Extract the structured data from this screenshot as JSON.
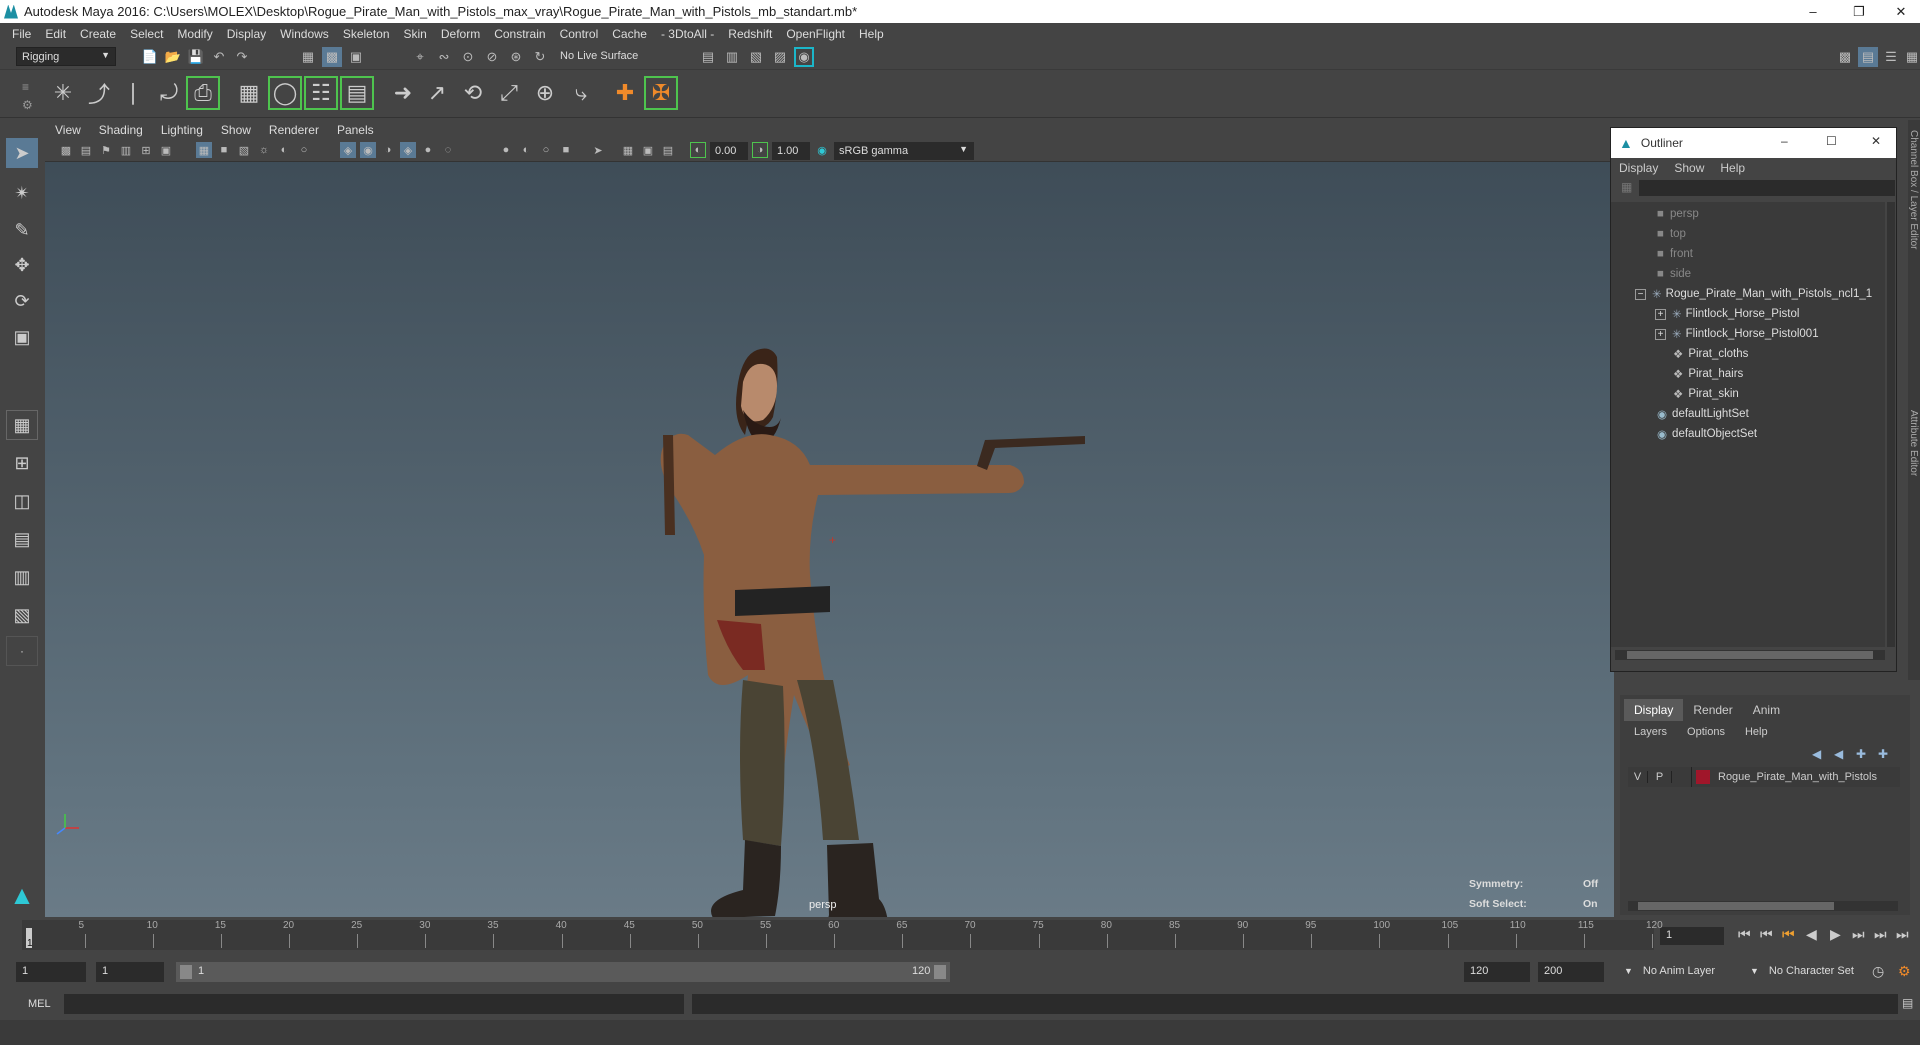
{
  "window": {
    "title": "Autodesk Maya 2016: C:\\Users\\MOLEX\\Desktop\\Rogue_Pirate_Man_with_Pistols_max_vray\\Rogue_Pirate_Man_with_Pistols_mb_standart.mb*"
  },
  "menu": [
    "File",
    "Edit",
    "Create",
    "Select",
    "Modify",
    "Display",
    "Windows",
    "Skeleton",
    "Skin",
    "Deform",
    "Constrain",
    "Control",
    "Cache",
    "- 3DtoAll -",
    "Redshift",
    "OpenFlight",
    "Help"
  ],
  "status": {
    "menuset": "Rigging",
    "live_surface": "No Live Surface"
  },
  "panel": {
    "menu": [
      "View",
      "Shading",
      "Lighting",
      "Show",
      "Renderer",
      "Panels"
    ],
    "near_value": "0.00",
    "far_value": "1.00",
    "color_space": "sRGB gamma",
    "camera_label": "persp"
  },
  "hud": {
    "symmetry_label": "Symmetry:",
    "symmetry_value": "Off",
    "soft_select_label": "Soft Select:",
    "soft_select_value": "On"
  },
  "outliner": {
    "title": "Outliner",
    "menu": [
      "Display",
      "Show",
      "Help"
    ],
    "items": [
      {
        "label": "persp",
        "dim": true
      },
      {
        "label": "top",
        "dim": true
      },
      {
        "label": "front",
        "dim": true
      },
      {
        "label": "side",
        "dim": true
      },
      {
        "label": "Rogue_Pirate_Man_with_Pistols_ncl1_1"
      },
      {
        "label": "Flintlock_Horse_Pistol"
      },
      {
        "label": "Flintlock_Horse_Pistol001"
      },
      {
        "label": "Pirat_cloths"
      },
      {
        "label": "Pirat_hairs"
      },
      {
        "label": "Pirat_skin"
      },
      {
        "label": "defaultLightSet"
      },
      {
        "label": "defaultObjectSet"
      }
    ]
  },
  "layers": {
    "tabs": [
      "Display",
      "Render",
      "Anim"
    ],
    "menu": [
      "Layers",
      "Options",
      "Help"
    ],
    "row": {
      "v": "V",
      "p": "P",
      "name": "Rogue_Pirate_Man_with_Pistols",
      "color": "#a0162a"
    }
  },
  "side_tabs": [
    "Channel Box / Layer Editor",
    "Attribute Editor"
  ],
  "timeline": {
    "ticks": [
      "5",
      "10",
      "15",
      "20",
      "25",
      "30",
      "35",
      "40",
      "45",
      "50",
      "55",
      "60",
      "65",
      "70",
      "75",
      "80",
      "85",
      "90",
      "95",
      "100",
      "105",
      "110",
      "115",
      "120"
    ],
    "current_frame": "1",
    "current_frame_field": "1"
  },
  "range": {
    "start": "1",
    "playback_start": "1",
    "slider_start": "1",
    "slider_end": "120",
    "playback_end": "120",
    "end": "200",
    "anim_layer": "No Anim Layer",
    "character_set": "No Character Set"
  },
  "command": {
    "label": "MEL"
  }
}
